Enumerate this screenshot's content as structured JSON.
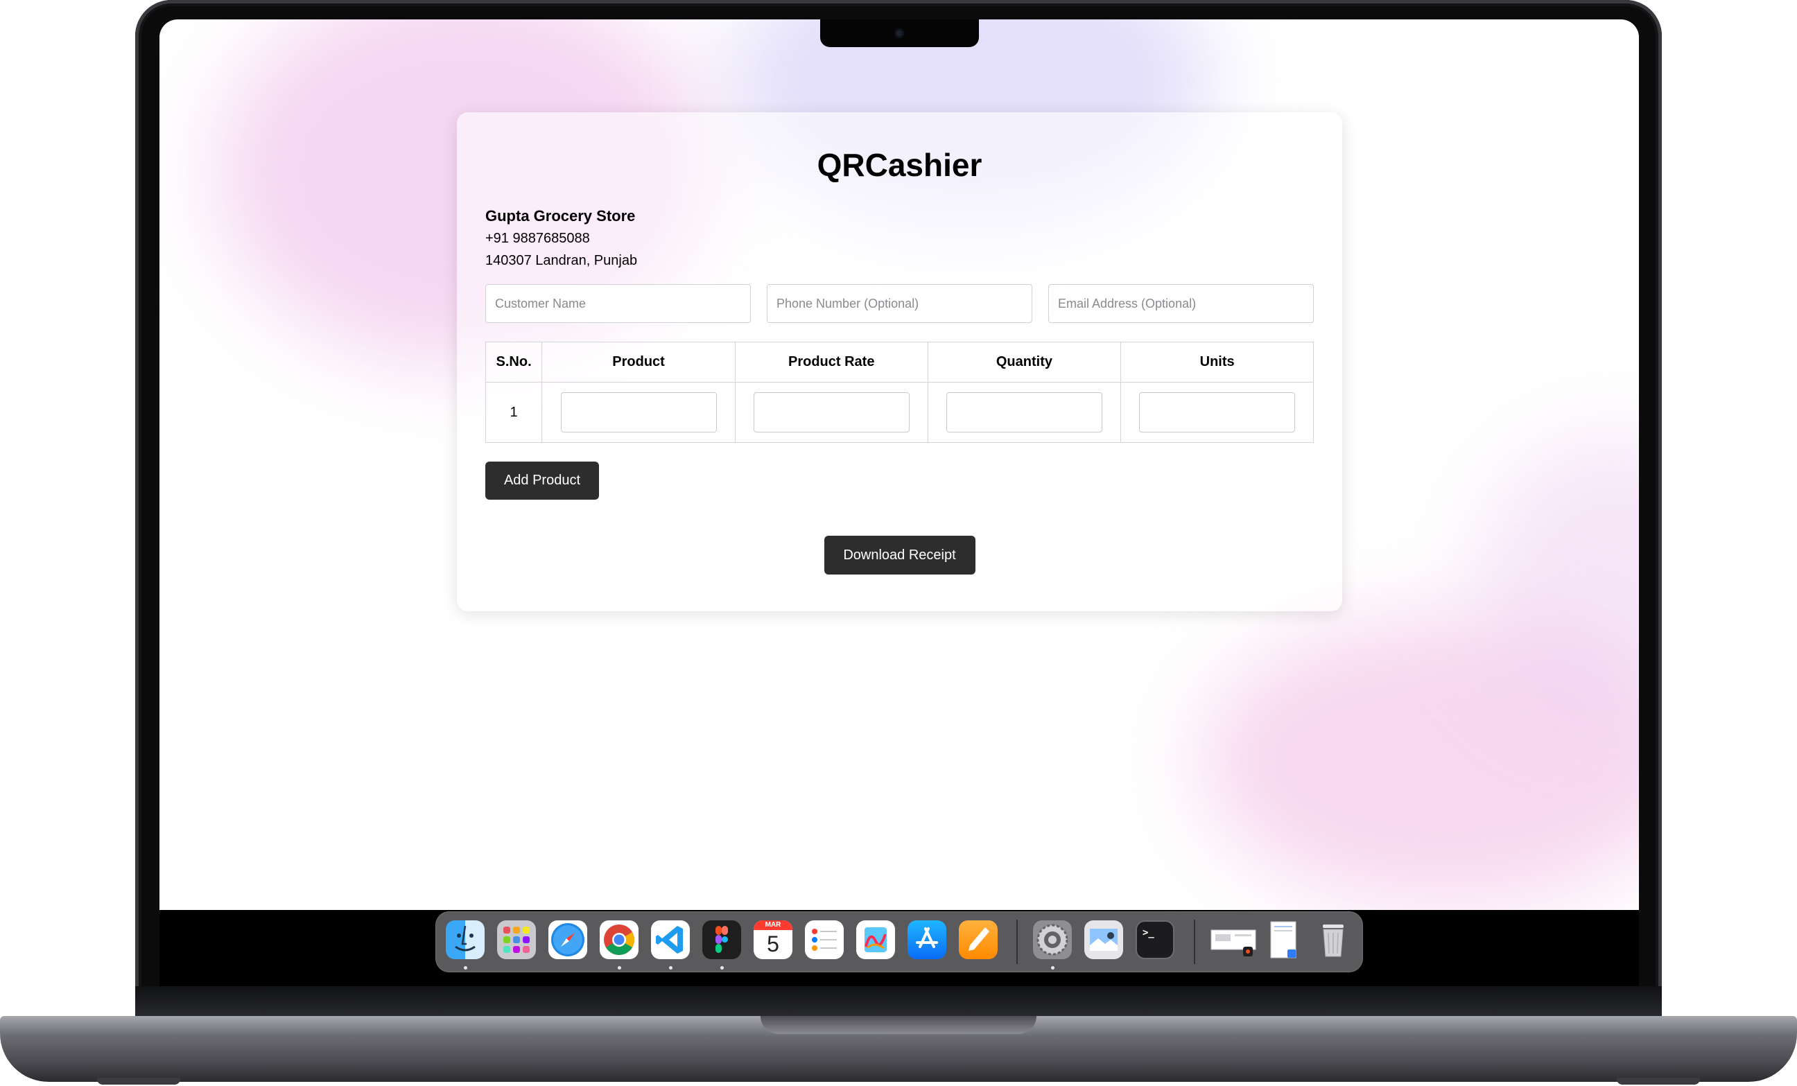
{
  "app": {
    "title": "QRCashier"
  },
  "store": {
    "name": "Gupta Grocery Store",
    "phone": "+91 9887685088",
    "address": "140307 Landran, Punjab"
  },
  "customer_fields": {
    "name_placeholder": "Customer Name",
    "phone_placeholder": "Phone Number (Optional)",
    "email_placeholder": "Email Address (Optional)"
  },
  "table": {
    "headers": [
      "S.No.",
      "Product",
      "Product Rate",
      "Quantity",
      "Units"
    ],
    "rows": [
      {
        "sno": "1",
        "product": "",
        "rate": "",
        "quantity": "",
        "units": ""
      }
    ]
  },
  "buttons": {
    "add_product": "Add Product",
    "download_receipt": "Download Receipt"
  },
  "dock": {
    "calendar_month": "MAR",
    "calendar_day": "5",
    "terminal_prompt": ">_",
    "apps": [
      "finder-icon",
      "launchpad-icon",
      "safari-icon",
      "chrome-icon",
      "vscode-icon",
      "figma-icon",
      "calendar-icon",
      "reminders-icon",
      "freeform-icon",
      "app-store-icon",
      "pages-icon",
      "system-settings-icon",
      "preview-icon",
      "terminal-icon",
      "stack-icon",
      "document-icon",
      "trash-icon"
    ]
  },
  "colors": {
    "button_bg": "#2d2d2d",
    "button_text": "#ffffff",
    "card_bg": "#ffffff",
    "accent_pink": "#ecb6e8",
    "accent_lavender": "#cec4f6"
  }
}
